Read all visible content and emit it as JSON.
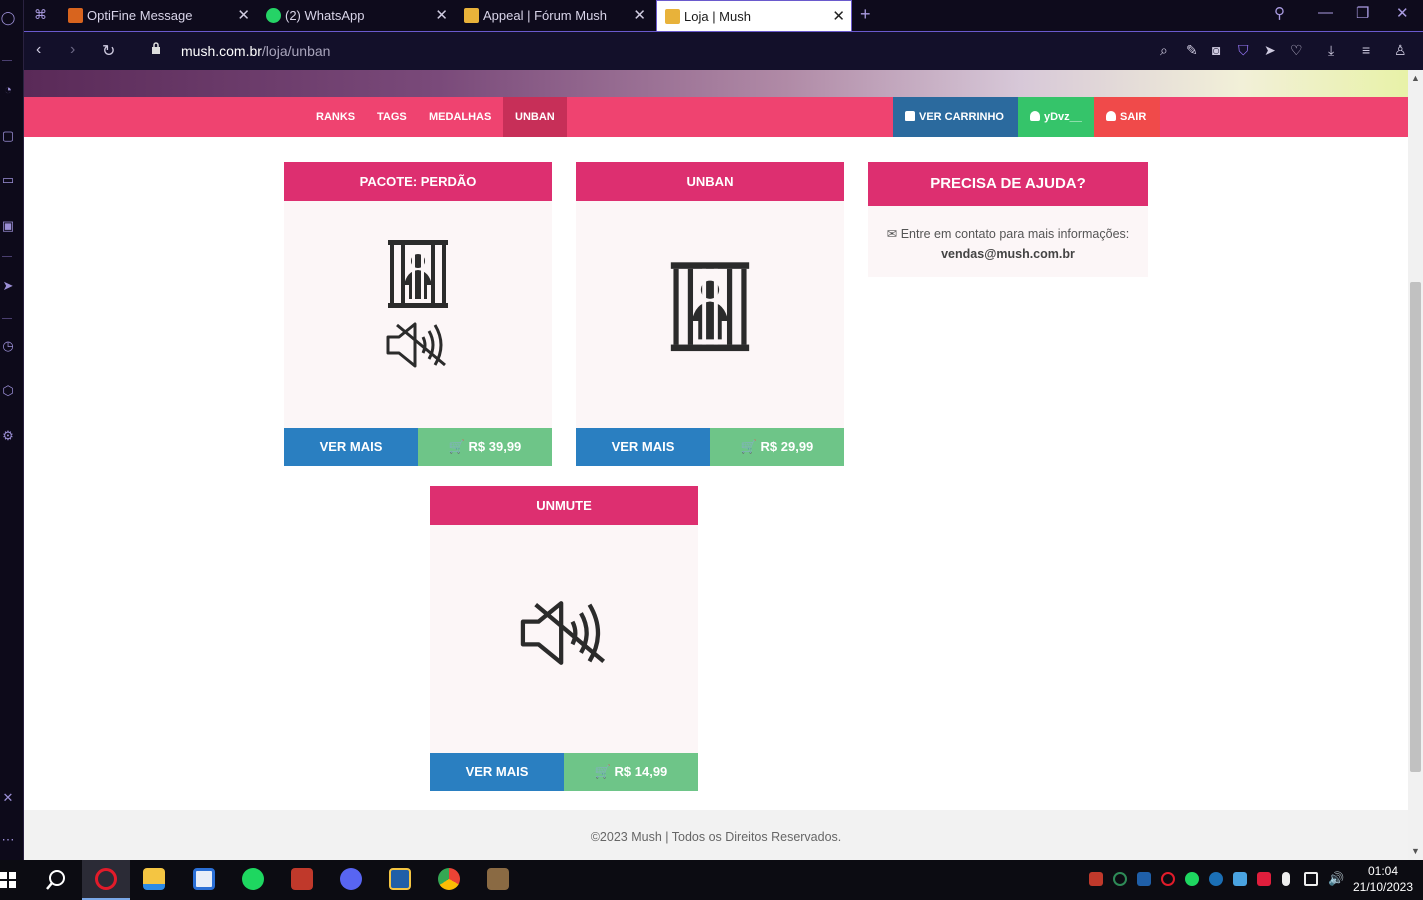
{
  "browser": {
    "tabs": [
      {
        "label": "OptiFine Message",
        "favicon": "optifine-icon"
      },
      {
        "label": "(2) WhatsApp",
        "favicon": "whatsapp-icon"
      },
      {
        "label": "Appeal | Fórum Mush",
        "favicon": "mush-icon"
      },
      {
        "label": "Loja | Mush",
        "favicon": "mush-icon"
      }
    ],
    "active_tab": 3,
    "url_domain": "mush.com.br",
    "url_path": "/loja/unban"
  },
  "nav": {
    "links": [
      "RANKS",
      "TAGS",
      "MEDALHAS",
      "UNBAN"
    ],
    "active": "UNBAN",
    "cart_label": "VER CARRINHO",
    "user_label": "yDvz__",
    "logout_label": "SAIR"
  },
  "products": [
    {
      "title": "PACOTE: PERDÃO",
      "more": "VER MAIS",
      "price": "R$ 39,99",
      "icons": [
        "jail-icon",
        "mute-icon"
      ]
    },
    {
      "title": "UNBAN",
      "more": "VER MAIS",
      "price": "R$ 29,99",
      "icons": [
        "jail-icon"
      ]
    },
    {
      "title": "UNMUTE",
      "more": "VER MAIS",
      "price": "R$ 14,99",
      "icons": [
        "mute-icon"
      ]
    }
  ],
  "help": {
    "title": "PRECISA DE AJUDA?",
    "text": "Entre em contato para mais informações:",
    "email": "vendas@mush.com.br"
  },
  "footer": {
    "text": "©2023 Mush | Todos os Direitos Reservados."
  },
  "taskbar": {
    "time": "01:04",
    "date": "21/10/2023"
  },
  "colors": {
    "nav_bg": "#ef4370",
    "nav_active": "#c72f58",
    "card_header": "#dd2f70",
    "btn_more": "#2a7fc1",
    "btn_price": "#6ec588",
    "cart_btn": "#2b6a9e",
    "user_btn": "#35c46a",
    "logout_btn": "#f04a4a"
  }
}
